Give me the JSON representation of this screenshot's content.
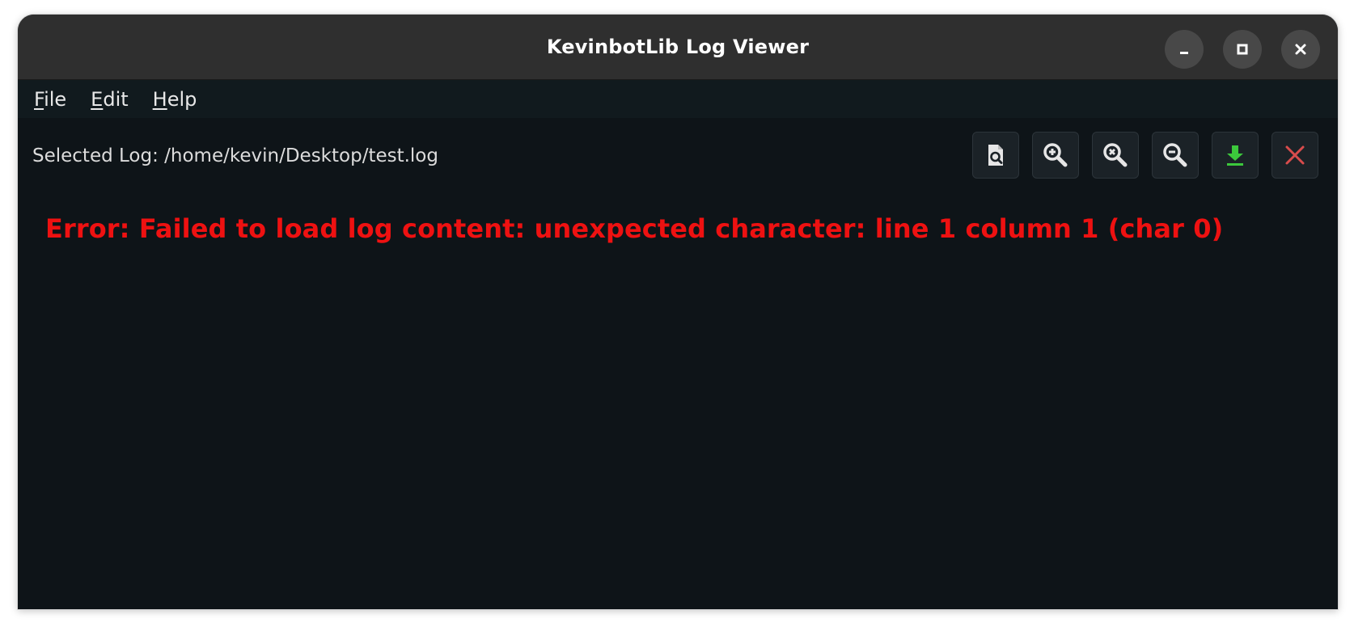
{
  "window": {
    "title": "KevinbotLib Log Viewer",
    "controls": {
      "minimize_icon": "minimize-icon",
      "maximize_icon": "maximize-icon",
      "close_icon": "close-icon"
    }
  },
  "menu": {
    "items": [
      {
        "mnemonic": "F",
        "rest": "ile"
      },
      {
        "mnemonic": "E",
        "rest": "dit"
      },
      {
        "mnemonic": "H",
        "rest": "elp"
      }
    ]
  },
  "log": {
    "selected_label": "Selected Log: /home/kevin/Desktop/test.log",
    "error": "Error: Failed to load log content: unexpected character: line 1 column 1 (char 0)"
  },
  "toolbar": {
    "buttons": [
      {
        "icon": "file-search-icon"
      },
      {
        "icon": "zoom-in-icon"
      },
      {
        "icon": "zoom-reset-icon"
      },
      {
        "icon": "zoom-out-icon"
      },
      {
        "icon": "download-icon"
      },
      {
        "icon": "close-log-icon"
      }
    ]
  },
  "colors": {
    "error": "#ee1111",
    "download": "#3cc83c",
    "close_log": "#d94c4c",
    "background": "#0e1418"
  }
}
